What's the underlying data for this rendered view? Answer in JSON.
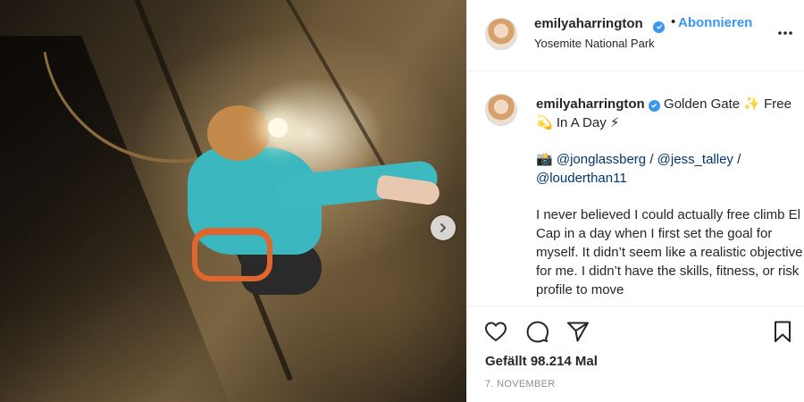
{
  "post": {
    "username": "emilyaharrington",
    "follow_label": "Abonnieren",
    "separator": "•",
    "location": "Yosemite National Park"
  },
  "caption": {
    "username": "emilyaharrington",
    "title": "Golden Gate ✨ Free 💫 In A Day ⚡",
    "camera_emoji": "📸",
    "mentions": [
      "@jonglassberg",
      "@jess_talley",
      "@louderthan11"
    ],
    "mention_sep": " / ",
    "body": "I never believed I could actually free climb El Cap in a day when I first set the goal for myself. It didn’t seem like a realistic objective for me. I didn’t have the skills, fitness, or risk profile to move"
  },
  "stats": {
    "likes": "Gefällt 98.214 Mal",
    "date": "7. NOVEMBER"
  },
  "icons": {
    "verified": "verified-badge-icon",
    "more": "more-options-icon",
    "next": "chevron-right-icon",
    "like": "heart-icon",
    "comment": "comment-bubble-icon",
    "share": "paper-plane-icon",
    "save": "bookmark-icon"
  },
  "colors": {
    "accent": "#3897f0",
    "mention": "#00376b",
    "text": "#262626",
    "muted": "#8e8e8e"
  }
}
